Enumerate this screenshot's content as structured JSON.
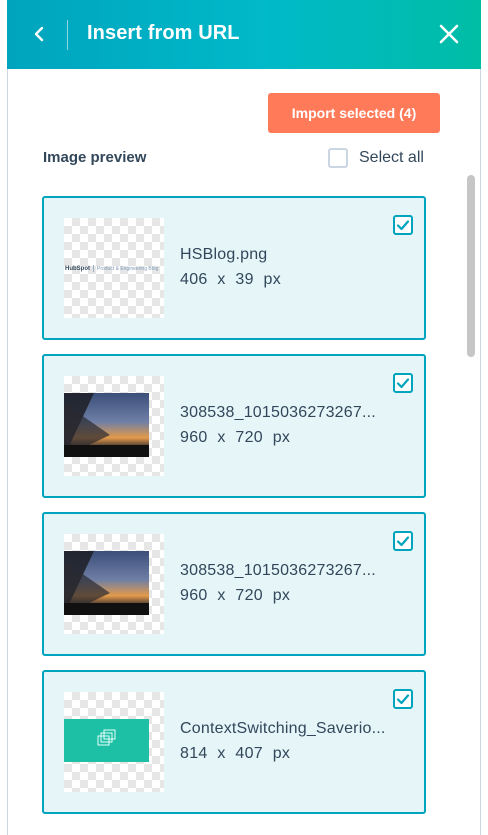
{
  "header": {
    "title": "Insert from URL",
    "back_icon": "chevron-left-icon",
    "close_icon": "close-icon",
    "gradient_start": "#00a4bd",
    "gradient_end": "#00bda5"
  },
  "toolbar": {
    "import_label": "Import selected (4)",
    "import_color": "#ff7a59"
  },
  "preview": {
    "label": "Image preview",
    "select_all_label": "Select all",
    "select_all_checked": false
  },
  "images": [
    {
      "name": "HSBlog.png",
      "dims": "406 x 39 px",
      "checked": true,
      "thumb": "hubspot-logo-thumbnail",
      "logo_brand": "HubSpot",
      "logo_caption": "Product & Engineering Blog"
    },
    {
      "name": "308538_1015036273267...",
      "dims": "960 x 720 px",
      "checked": true,
      "thumb": "sunset-photo-thumbnail"
    },
    {
      "name": "308538_1015036273267...",
      "dims": "960 x 720 px",
      "checked": true,
      "thumb": "sunset-photo-thumbnail"
    },
    {
      "name": "ContextSwitching_Saverio...",
      "dims": "814 x 407 px",
      "checked": true,
      "thumb": "teal-slide-thumbnail"
    }
  ],
  "colors": {
    "card_bg": "#e5f5f8",
    "card_border": "#00a4bd",
    "text": "#33475b"
  }
}
